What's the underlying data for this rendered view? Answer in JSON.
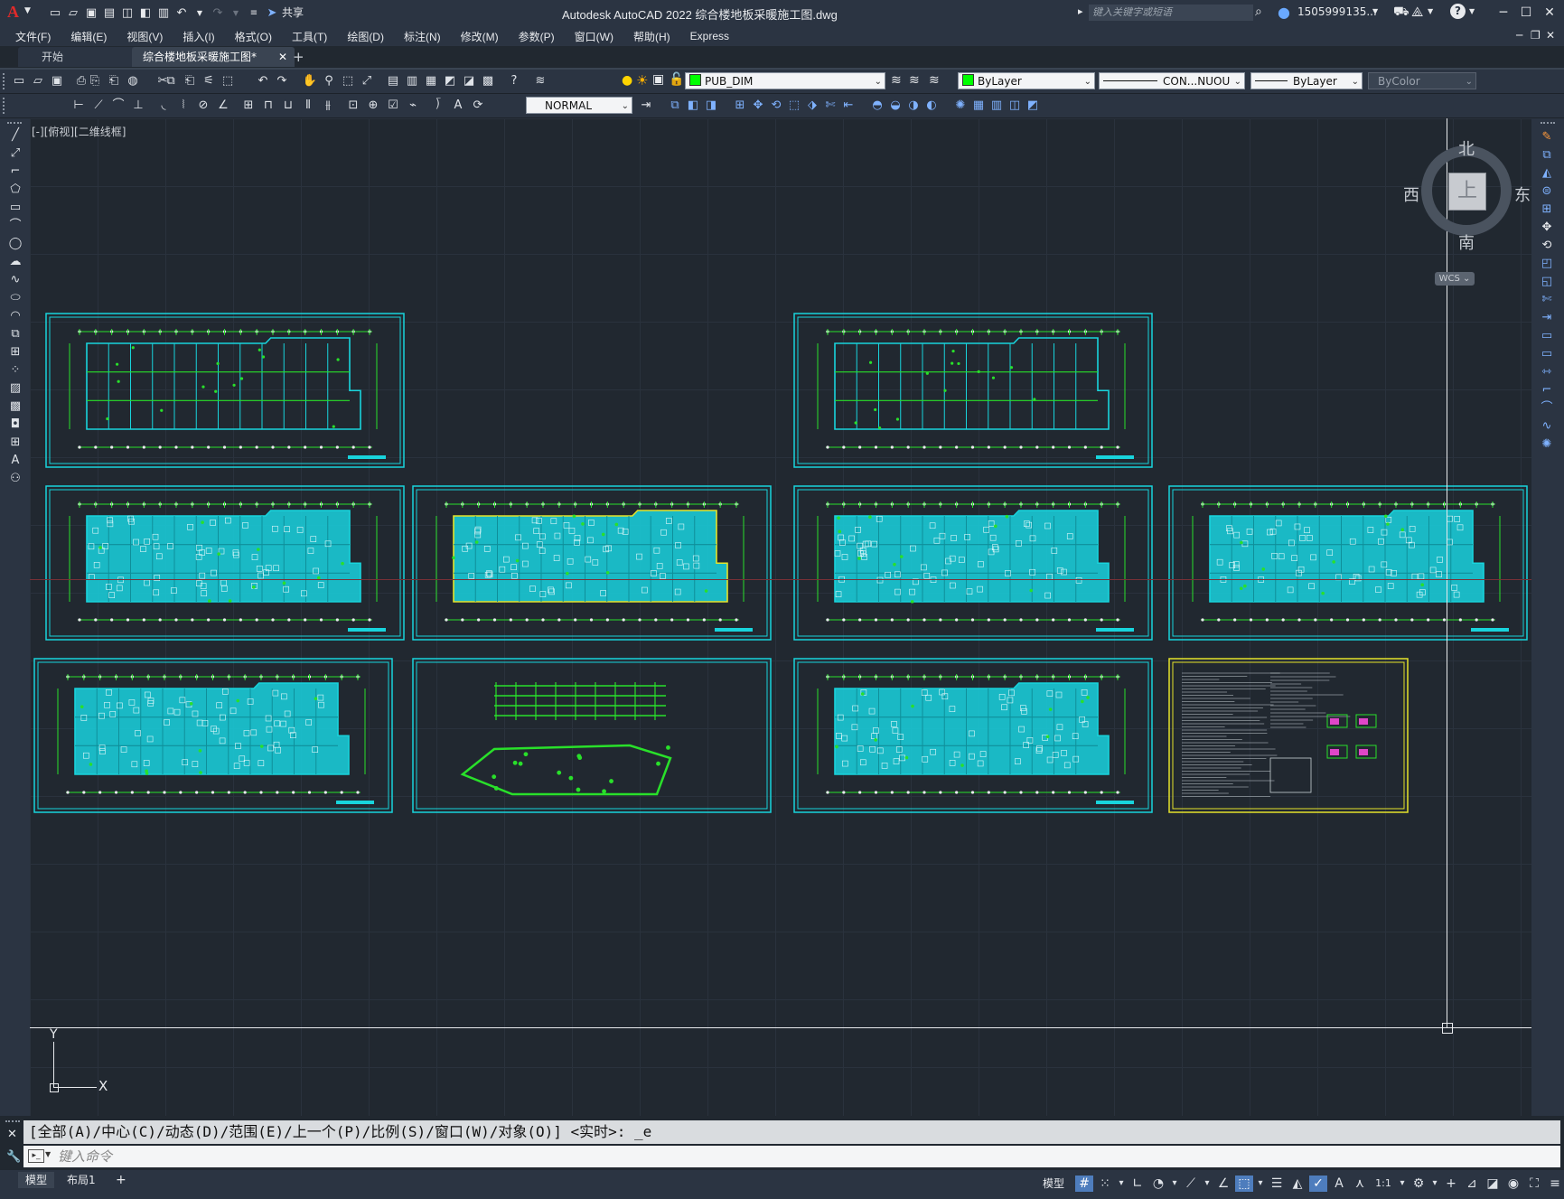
{
  "app": {
    "title": "Autodesk AutoCAD 2022    综合楼地板采暖施工图.dwg",
    "logo": "A",
    "share_label": "共享",
    "search_placeholder": "键入关键字或短语",
    "user": "1505999135...",
    "brand_color": "#d4202a"
  },
  "menu": [
    {
      "label": "文件(F)"
    },
    {
      "label": "编辑(E)"
    },
    {
      "label": "视图(V)"
    },
    {
      "label": "插入(I)"
    },
    {
      "label": "格式(O)"
    },
    {
      "label": "工具(T)"
    },
    {
      "label": "绘图(D)"
    },
    {
      "label": "标注(N)"
    },
    {
      "label": "修改(M)"
    },
    {
      "label": "参数(P)"
    },
    {
      "label": "窗口(W)"
    },
    {
      "label": "帮助(H)"
    },
    {
      "label": "Express"
    }
  ],
  "tabs": [
    {
      "label": "开始"
    },
    {
      "label": "综合楼地板采暖施工图*"
    }
  ],
  "toolbar": {
    "layer": "PUB_DIM",
    "layer_color": "#00ff00",
    "color": "ByLayer",
    "linetype": "CON...NUOU",
    "lineweight": "ByLayer",
    "plotstyle": "ByColor",
    "dimstyle": "NORMAL"
  },
  "viewport_label": "[-][俯视][二维线框]",
  "viewcube": {
    "north": "北",
    "south": "南",
    "east": "东",
    "west": "西",
    "top": "上",
    "wcs": "WCS"
  },
  "command": {
    "history": "[全部(A)/中心(C)/动态(D)/范围(E)/上一个(P)/比例(S)/窗口(W)/对象(O)] <实时>: _e",
    "placeholder": "键入命令"
  },
  "status": {
    "tabs": [
      {
        "label": "模型"
      },
      {
        "label": "布局1"
      }
    ],
    "model_label": "模型",
    "scale": "1:1"
  },
  "ucs": {
    "y": "Y",
    "x": "X"
  }
}
